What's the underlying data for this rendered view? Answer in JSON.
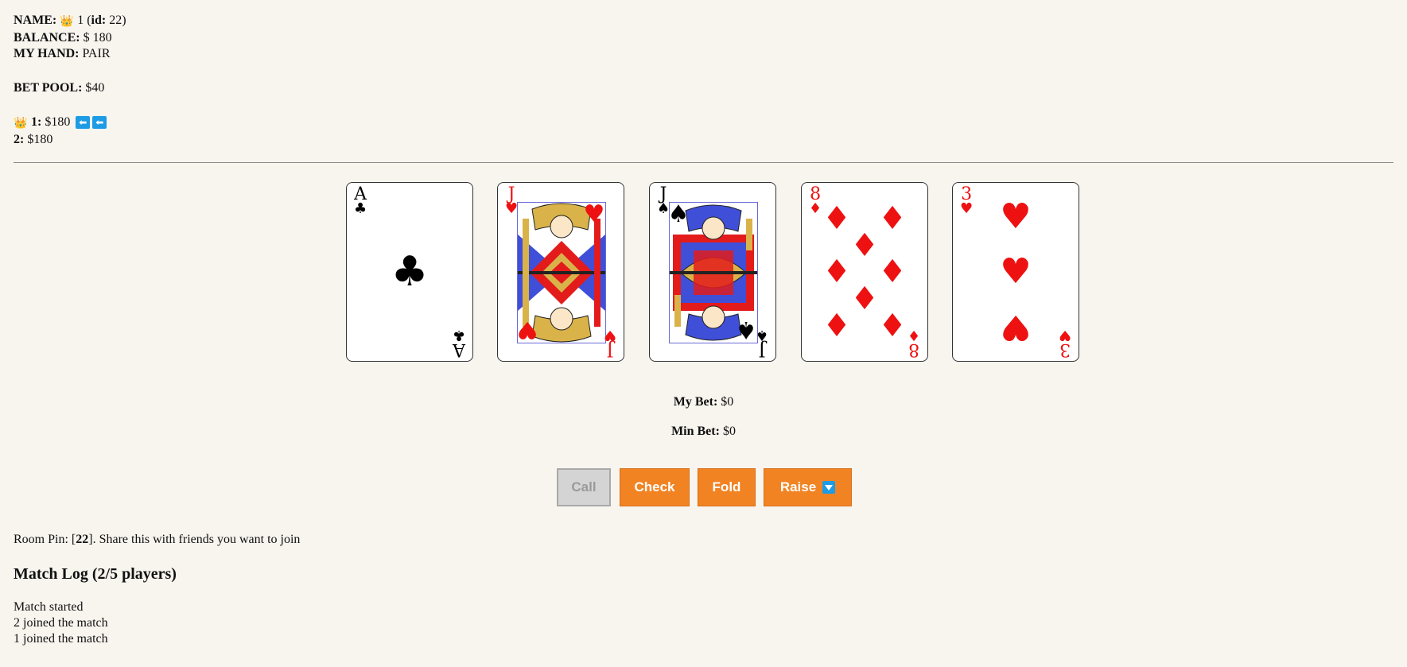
{
  "player": {
    "name_label": "NAME:",
    "crown_icon": "👑",
    "name": "1",
    "id_open": "(",
    "id_label": "id:",
    "id_value": "22)",
    "balance_label": "BALANCE:",
    "balance": "$ 180",
    "hand_label": "MY HAND:",
    "hand": "PAIR"
  },
  "pool": {
    "label": "BET POOL:",
    "value": "$40"
  },
  "players": [
    {
      "name": "1:",
      "balance": "$180",
      "is_me": true,
      "badges": [
        "⬅",
        "⬅"
      ]
    },
    {
      "name": "2:",
      "balance": "$180",
      "is_me": false
    }
  ],
  "cards": [
    {
      "rank": "A",
      "suit": "♣",
      "color": "black"
    },
    {
      "rank": "J",
      "suit": "♥",
      "color": "red"
    },
    {
      "rank": "J",
      "suit": "♠",
      "color": "black"
    },
    {
      "rank": "8",
      "suit": "♦",
      "color": "red"
    },
    {
      "rank": "3",
      "suit": "♥",
      "color": "red"
    }
  ],
  "bets": {
    "my_bet_label": "My Bet:",
    "my_bet": "$0",
    "min_bet_label": "Min Bet:",
    "min_bet": "$0"
  },
  "actions": {
    "call": "Call",
    "check": "Check",
    "fold": "Fold",
    "raise": "Raise",
    "raise_icon": "dropdown-arrow-icon"
  },
  "room": {
    "pin_prefix": "Room Pin: [",
    "pin": "22",
    "pin_suffix": "]. Share this with friends you want to join"
  },
  "log": {
    "title": "Match Log (2/5 players)",
    "entries": [
      "Match started",
      "2 joined the match",
      "1 joined the match"
    ]
  },
  "colors": {
    "background": "#f8f4ee",
    "button": "#f28322",
    "badge": "#1e9be5",
    "red_suit": "#ee1111"
  }
}
